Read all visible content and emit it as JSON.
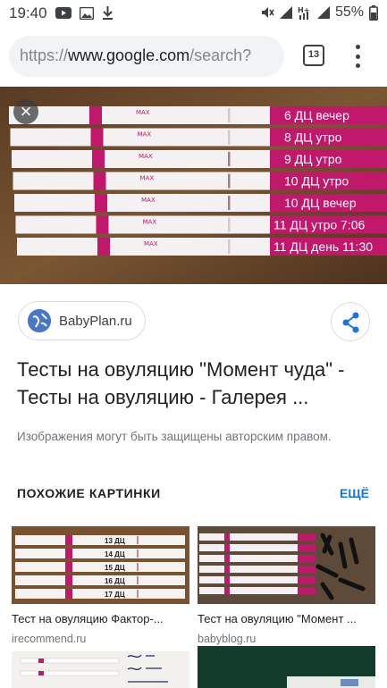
{
  "status_bar": {
    "time": "19:40",
    "battery": "55%",
    "left_icons": [
      "youtube-icon",
      "image-icon",
      "download-icon"
    ],
    "right_icons": [
      "mute-icon",
      "signal-icon",
      "hplus-icon",
      "signal-icon",
      "battery-icon"
    ]
  },
  "browser": {
    "url_scheme": "https://",
    "url_host": "www.google.com",
    "url_tail": "/search?",
    "tab_count": "13"
  },
  "hero": {
    "strip_labels": [
      "6 ДЦ вечер",
      "8 ДЦ утро",
      "9 ДЦ утро",
      "10 ДЦ утро",
      "10 ДЦ вечер",
      "11 ДЦ утро 7:06",
      "11 ДЦ день 11:30"
    ],
    "max_label": "MAX"
  },
  "source": {
    "name": "BabyPlan.ru"
  },
  "result": {
    "title": "Тесты на овуляцию \"Момент чуда\" - Тесты на овуляцию - Галерея ...",
    "copyright": "Изображения могут быть защищены авторским правом."
  },
  "similar": {
    "heading": "ПОХОЖИЕ КАРТИНКИ",
    "more": "ЕЩЁ",
    "cards": [
      {
        "title": "Тест на овуляцию Фактор-...",
        "site": "irecommend.ru",
        "strip_labels": [
          "13 ДЦ",
          "14 ДЦ",
          "15 ДЦ",
          "16 ДЦ",
          "17 ДЦ"
        ]
      },
      {
        "title": "Тест на овуляцию \"Момент ...",
        "site": "babyblog.ru"
      }
    ]
  },
  "colors": {
    "accent": "#1a73e8",
    "strip_pink": "#c2186b",
    "wood": "#6b4b2e"
  }
}
